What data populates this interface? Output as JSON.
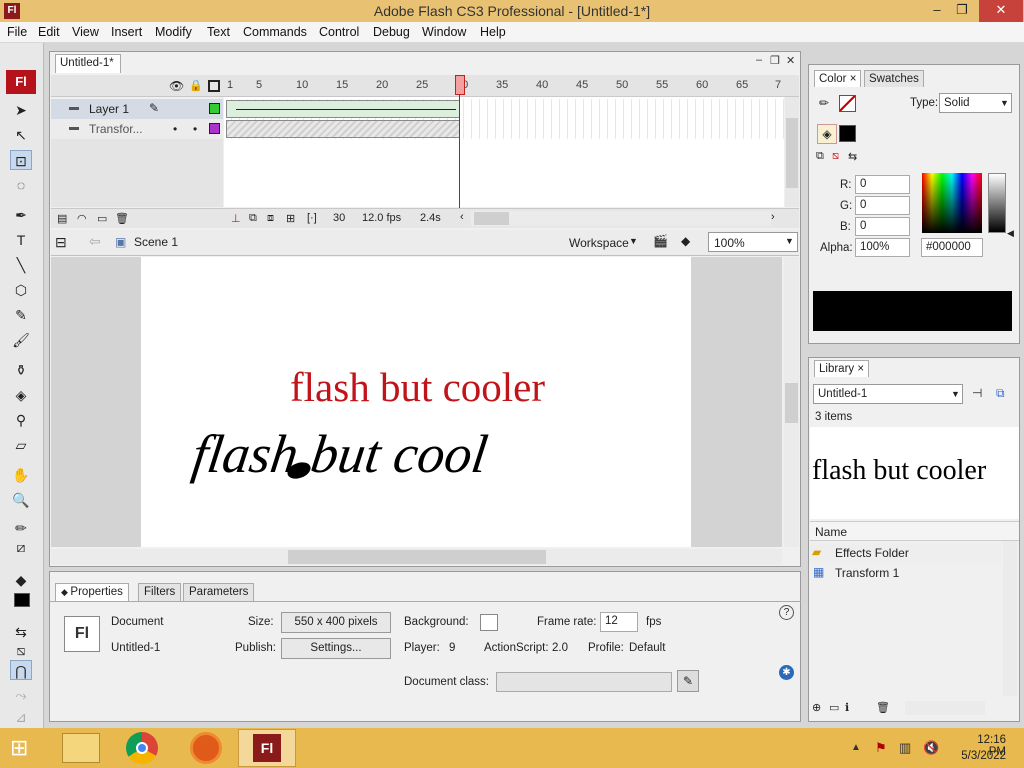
{
  "window": {
    "title": "Adobe Flash CS3 Professional - [Untitled-1*]",
    "app_icon": "Fl",
    "minimize": "–",
    "restore": "❐",
    "close": "✕"
  },
  "menu": [
    "File",
    "Edit",
    "View",
    "Insert",
    "Modify",
    "Text",
    "Commands",
    "Control",
    "Debug",
    "Window",
    "Help"
  ],
  "tools": {
    "logo": "Fl"
  },
  "document_tab": "Untitled-1*",
  "timeline": {
    "ruler": [
      "1",
      "5",
      "10",
      "15",
      "20",
      "25",
      "30",
      "35",
      "40",
      "45",
      "50",
      "55",
      "60",
      "65",
      "7"
    ],
    "layers": [
      "Layer 1",
      "Transfor..."
    ],
    "current_frame": "30",
    "frame_rate": "12.0 fps",
    "elapsed": "2.4s"
  },
  "scene": {
    "name": "Scene 1",
    "workspace": "Workspace",
    "zoom": "100%"
  },
  "stage": {
    "text_red": "flash but cooler",
    "text_black": "flash but cool",
    "red_color": "#c0141a"
  },
  "properties": {
    "tabs": [
      "Properties",
      "Filters",
      "Parameters"
    ],
    "icon": "Fl",
    "type": "Document",
    "name": "Untitled-1",
    "size_label": "Size:",
    "size_value": "550 x 400 pixels",
    "publish_label": "Publish:",
    "settings_btn": "Settings...",
    "background_label": "Background:",
    "frame_rate_label": "Frame rate:",
    "frame_rate_value": "12",
    "fps": "fps",
    "player_label": "Player:",
    "player_value": "9",
    "actionscript_label": "ActionScript:",
    "actionscript_value": "2.0",
    "profile_label": "Profile:",
    "profile_value": "Default",
    "doc_class_label": "Document class:"
  },
  "color": {
    "tabs": [
      "Color",
      "Swatches"
    ],
    "type_label": "Type:",
    "type_value": "Solid",
    "r_label": "R:",
    "r": "0",
    "g_label": "G:",
    "g": "0",
    "b_label": "B:",
    "b": "0",
    "alpha_label": "Alpha:",
    "alpha": "100%",
    "hex": "#000000"
  },
  "library": {
    "tab": "Library",
    "doc": "Untitled-1",
    "count": "3 items",
    "preview": "flash but cooler",
    "name_header": "Name",
    "items": [
      "Effects Folder",
      "Transform 1"
    ]
  },
  "taskbar": {
    "time": "12:16 PM",
    "date": "5/3/2022",
    "flash_icon": "Fl"
  }
}
